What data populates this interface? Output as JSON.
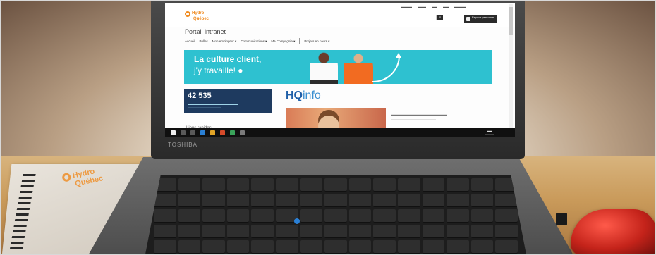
{
  "screen": {
    "logo": {
      "line1": "Hydro",
      "line2": "Québec"
    },
    "title": "Portail intranet",
    "nav": [
      "Accueil",
      "Bulles",
      "Mon employeur ▾",
      "Communications ▾",
      "Ma Compagnie ▾",
      "Projets en cours ▾"
    ],
    "banner": {
      "line1": "La culture client,",
      "line2": "j'y travaille! ●"
    },
    "stat": {
      "number": "42 535"
    },
    "hqinfo": {
      "bold": "HQ",
      "rest": "info"
    },
    "links_title": "Liens rapides",
    "account_label": "Espace personnel"
  },
  "laptop": {
    "brand": "TOSHIBA"
  },
  "notebook": {
    "logo_line1": "Hydro",
    "logo_line2": "Québec"
  },
  "colors": {
    "banner": "#2ec1d0",
    "stat_bg": "#1e3a5f",
    "brand_orange": "#f08a1e",
    "mouse_red": "#c4231a"
  },
  "icons": [
    "search-icon",
    "trackpoint",
    "wireless-mouse",
    "usb-receiver"
  ]
}
